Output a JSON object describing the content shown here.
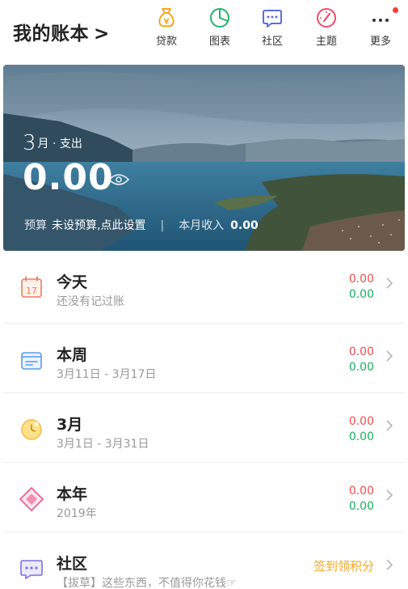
{
  "header": {
    "title": "我的账本",
    "title_chevron": ">",
    "nav": [
      {
        "label": "贷款",
        "icon": "money-bag-icon",
        "color": "#f5a623"
      },
      {
        "label": "图表",
        "icon": "pie-chart-icon",
        "color": "#21b36b"
      },
      {
        "label": "社区",
        "icon": "chat-bubble-icon",
        "color": "#5b6ee1"
      },
      {
        "label": "主题",
        "icon": "theme-gauge-icon",
        "color": "#f14a6b"
      },
      {
        "label": "更多",
        "icon": "more-dots-icon",
        "color": "#333333"
      }
    ]
  },
  "hero": {
    "month_num": "3",
    "month_suffix": "月 · 支出",
    "amount": "0.00",
    "budget_label": "预算",
    "budget_value": "未设预算,点此设置",
    "separator": "|",
    "income_label": "本月收入",
    "income_value": "0.00"
  },
  "list": {
    "today": {
      "title": "今天",
      "subtitle": "还没有记过账",
      "expense": "0.00",
      "income": "0.00",
      "icon_text": "17"
    },
    "week": {
      "title": "本周",
      "subtitle": "3月11日 - 3月17日",
      "expense": "0.00",
      "income": "0.00"
    },
    "month": {
      "title": "3月",
      "subtitle": "3月1日 - 3月31日",
      "expense": "0.00",
      "income": "0.00"
    },
    "year": {
      "title": "本年",
      "subtitle": "2019年",
      "expense": "0.00",
      "income": "0.00"
    },
    "community": {
      "title": "社区",
      "subtitle": "【拔草】这些东西，不值得你花钱☞",
      "promo": "签到领积分"
    }
  },
  "colors": {
    "expense": "#f24b4b",
    "income": "#17b05d",
    "promo": "#f5a623"
  }
}
